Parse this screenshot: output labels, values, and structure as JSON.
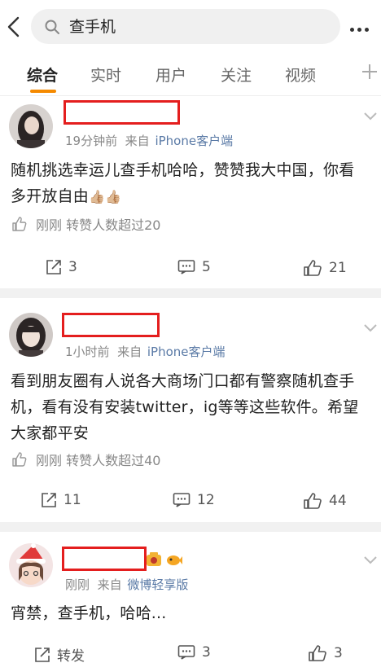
{
  "search": {
    "query": "查手机"
  },
  "tabs": [
    {
      "label": "综合"
    },
    {
      "label": "实时"
    },
    {
      "label": "用户"
    },
    {
      "label": "关注"
    },
    {
      "label": "视频"
    }
  ],
  "posts": [
    {
      "time": "19分钟前",
      "source_prefix": "来自",
      "source": "iPhone客户端",
      "text_line1": "随机挑选幸运儿查手机哈哈，赞赞我大中国，你看",
      "text_line2": "多开放自由",
      "text_emoji": "👍🏼👍🏼",
      "like_note": "刚刚 转赞人数超过20",
      "repost_count": "3",
      "comment_count": "5",
      "like_count": "21"
    },
    {
      "time": "1小时前",
      "source_prefix": "来自",
      "source": "iPhone客户端",
      "text_line1": "看到朋友圈有人说各大商场门口都有警察随机查手",
      "text_line2": "机，看有没有安装twitter，ig等等这些软件。希望",
      "text_line3": "大家都平安",
      "like_note": "刚刚 转赞人数超过40",
      "repost_count": "11",
      "comment_count": "12",
      "like_count": "44"
    },
    {
      "time": "刚刚",
      "source_prefix": "来自",
      "source": "微博轻享版",
      "text_line1": "宵禁，查手机，哈哈...",
      "repost_label": "转发",
      "comment_count": "3",
      "like_count": "3"
    }
  ],
  "icons": {
    "back": "chevron-left-icon",
    "search": "search-icon",
    "more": "more-horizontal-icon",
    "add_tab": "plus-icon",
    "repost": "repost-icon",
    "comment": "comment-icon",
    "like": "thumbs-up-icon"
  },
  "colors": {
    "accent": "#f58a00",
    "source_link": "#5a7aa6",
    "redaction": "#e41e1e"
  }
}
